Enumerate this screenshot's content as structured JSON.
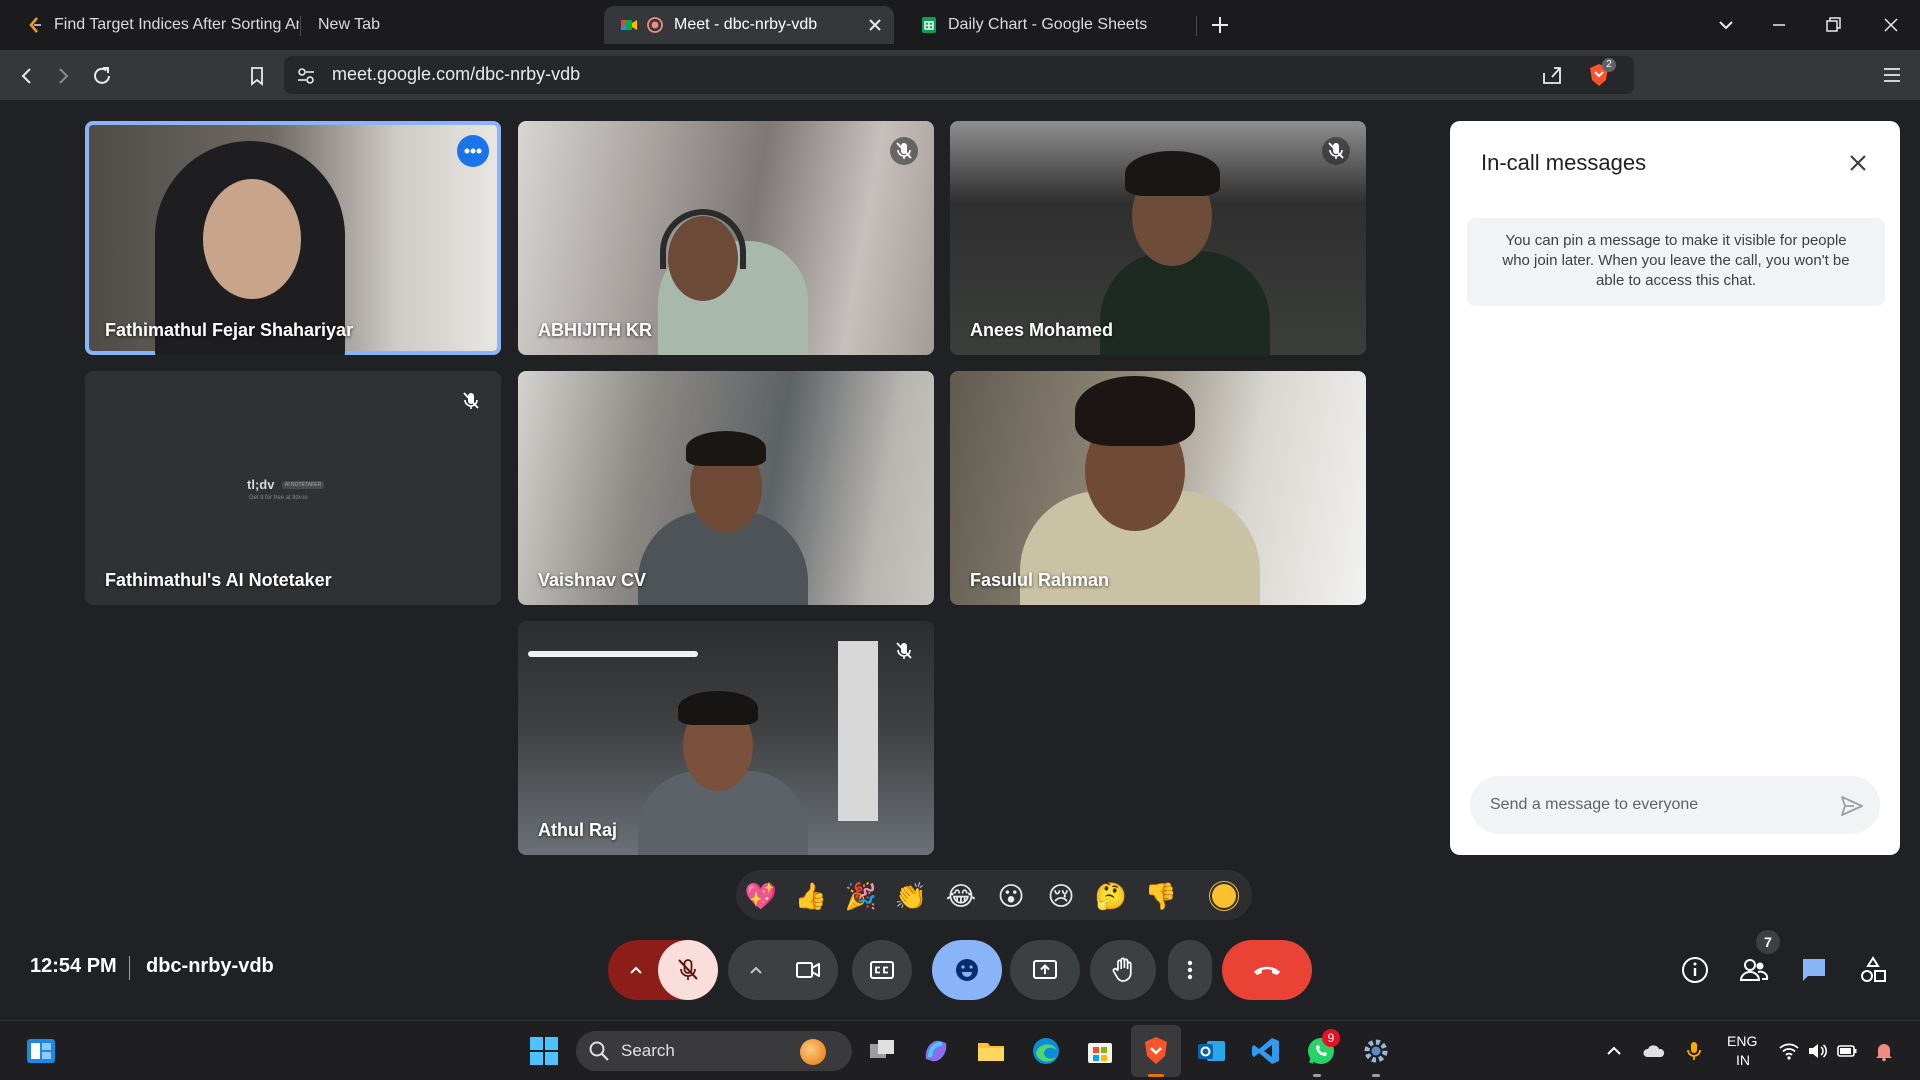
{
  "browser": {
    "tabs": [
      {
        "title": "Find Target Indices After Sorting Ar",
        "active": false
      },
      {
        "title": "New Tab",
        "active": false
      },
      {
        "title": "Meet - dbc-nrby-vdb",
        "active": true
      },
      {
        "title": "Daily Chart - Google Sheets",
        "active": false
      }
    ],
    "url": "meet.google.com/dbc-nrby-vdb",
    "extension_badge": "2"
  },
  "tiles": [
    {
      "name": "Fathimathul Fejar Shahariyar",
      "muted": false,
      "speaking": true,
      "bg": "#6b6660"
    },
    {
      "name": "ABHIJITH KR",
      "muted": true,
      "speaking": false,
      "bg": "#9a9593"
    },
    {
      "name": "Anees Mohamed",
      "muted": true,
      "speaking": false,
      "bg": "#3a3b3a"
    },
    {
      "name": "Fathimathul's AI Notetaker",
      "muted": true,
      "speaking": false,
      "bg": "#303134"
    },
    {
      "name": "Vaishnav CV",
      "muted": false,
      "speaking": false,
      "bg": "#8e8a86"
    },
    {
      "name": "Fasulul Rahman",
      "muted": false,
      "speaking": false,
      "bg": "#8a8070"
    },
    {
      "name": "Athul Raj",
      "muted": true,
      "speaking": false,
      "bg": "#5a5d60"
    }
  ],
  "notetaker": {
    "brand": "tl;dv",
    "tagline": "AI NOTETAKER",
    "sub": "Get it for free at tldv.io"
  },
  "chat": {
    "title": "In-call messages",
    "note": "You can pin a message to make it visible for people who join later. When you leave the call, you won't be able to access this chat.",
    "input_placeholder": "Send a message to everyone"
  },
  "reactions": [
    "💖",
    "👍",
    "🎉",
    "👏",
    "😂",
    "😮",
    "😢",
    "🤔",
    "👎"
  ],
  "meeting": {
    "time": "12:54 PM",
    "code": "dbc-nrby-vdb",
    "people_count": "7"
  },
  "taskbar": {
    "search_label": "Search",
    "lang_line1": "ENG",
    "lang_line2": "IN",
    "whatsapp_badge": "9"
  },
  "colors": {
    "accent": "#8ab4f8",
    "end_call": "#ea4335",
    "active_control": "#8ab4f8",
    "mic_off": "#f9dedc"
  }
}
